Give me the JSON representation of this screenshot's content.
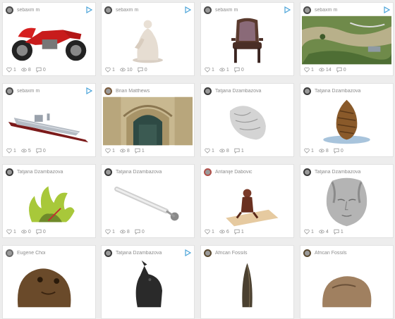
{
  "cards": [
    {
      "author": "sebaxm m",
      "avatar_color": "#4a4a4a",
      "play": true,
      "likes": "1",
      "views": "8",
      "comments": "0",
      "thumb": "motorcycle"
    },
    {
      "author": "sebaxm m",
      "avatar_color": "#4a4a4a",
      "play": true,
      "likes": "1",
      "views": "10",
      "comments": "0",
      "thumb": "statue"
    },
    {
      "author": "sebaxm m",
      "avatar_color": "#4a4a4a",
      "play": true,
      "likes": "1",
      "views": "1",
      "comments": "0",
      "thumb": "chair"
    },
    {
      "author": "sebaxm m",
      "avatar_color": "#4a4a4a",
      "play": true,
      "likes": "1",
      "views": "14",
      "comments": "0",
      "thumb": "terrain"
    },
    {
      "author": "sebaxm m",
      "avatar_color": "#4a4a4a",
      "play": true,
      "likes": "1",
      "views": "5",
      "comments": "0",
      "thumb": "ship"
    },
    {
      "author": "Brian Matthews",
      "avatar_color": "#7a5a3a",
      "play": false,
      "likes": "1",
      "views": "8",
      "comments": "1",
      "thumb": "doorway"
    },
    {
      "author": "Tatjana Dzambazova",
      "avatar_color": "#3a3a3a",
      "play": false,
      "likes": "1",
      "views": "8",
      "comments": "1",
      "thumb": "scan"
    },
    {
      "author": "Tatjana Dzambazova",
      "avatar_color": "#3a3a3a",
      "play": false,
      "likes": "1",
      "views": "8",
      "comments": "0",
      "thumb": "pinecone"
    },
    {
      "author": "Tatjana Dzambazova",
      "avatar_color": "#3a3a3a",
      "play": false,
      "likes": "1",
      "views": "0",
      "comments": "0",
      "thumb": "coral"
    },
    {
      "author": "Tatjana Dzambazova",
      "avatar_color": "#3a3a3a",
      "play": false,
      "likes": "1",
      "views": "8",
      "comments": "0",
      "thumb": "tool"
    },
    {
      "author": "Antanije Dabovic",
      "avatar_color": "#b0504a",
      "play": false,
      "likes": "1",
      "views": "6",
      "comments": "1",
      "thumb": "figurine"
    },
    {
      "author": "Tatjana Dzambazova",
      "avatar_color": "#3a3a3a",
      "play": false,
      "likes": "1",
      "views": "4",
      "comments": "1",
      "thumb": "face"
    },
    {
      "author": "Eugene Choi",
      "avatar_color": "#6a6a6a",
      "play": false,
      "likes": "",
      "views": "",
      "comments": "",
      "thumb": "bust"
    },
    {
      "author": "Tatjana Dzambazova",
      "avatar_color": "#3a3a3a",
      "play": true,
      "likes": "",
      "views": "",
      "comments": "",
      "thumb": "horse"
    },
    {
      "author": "African Fossils",
      "avatar_color": "#5a4a30",
      "play": false,
      "likes": "",
      "views": "",
      "comments": "",
      "thumb": "spear"
    },
    {
      "author": "African Fossils",
      "avatar_color": "#5a4a30",
      "play": false,
      "likes": "",
      "views": "",
      "comments": "",
      "thumb": "rock"
    }
  ],
  "colors": {
    "play": "#4aa3d8",
    "icon": "#9a9a9a"
  }
}
